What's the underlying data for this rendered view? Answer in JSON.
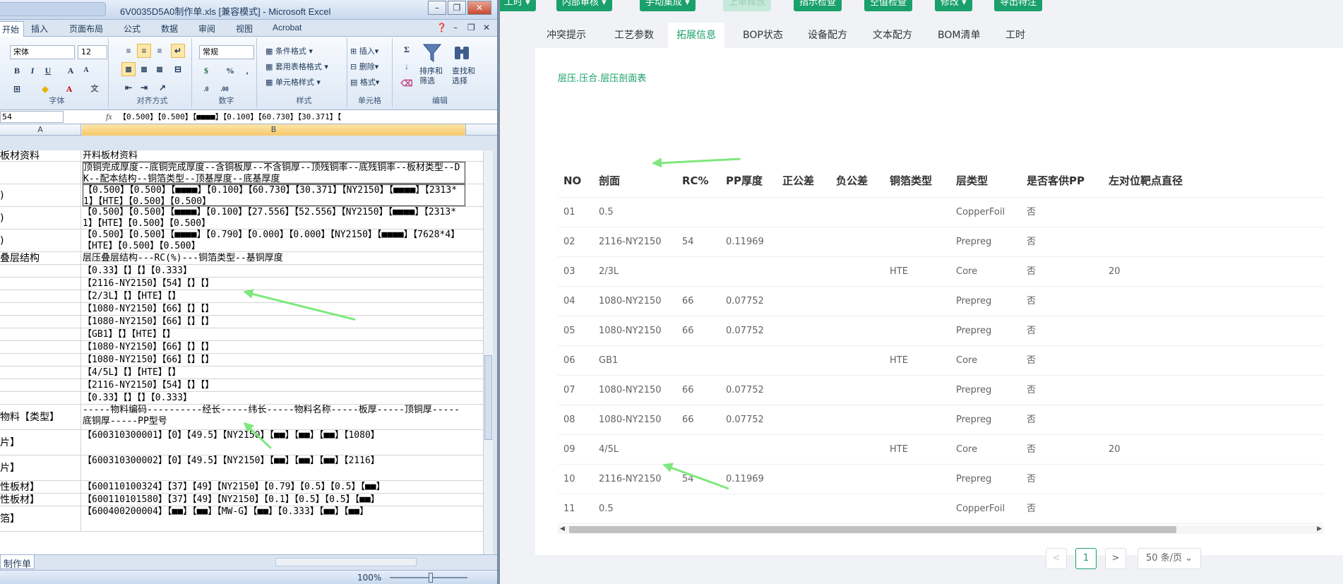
{
  "excel": {
    "title": "6V0035D5A0制作单.xls [兼容模式] - Microsoft Excel",
    "window_buttons": [
      "–",
      "❐",
      "✕"
    ],
    "tabs": [
      "开始",
      "插入",
      "页面布局",
      "公式",
      "数据",
      "审阅",
      "视图",
      "Acrobat"
    ],
    "ribbon": {
      "font_name": "宋体",
      "font_size": "12",
      "number_format": "常规",
      "font_group": "字体",
      "align_group": "对齐方式",
      "number_group": "数字",
      "style_group": "样式",
      "cells_group": "单元格",
      "edit_group": "编辑",
      "cond_format": "条件格式",
      "table_format": "套用表格格式",
      "cell_style": "单元格样式",
      "insert": "插入",
      "delete": "删除",
      "format": "格式",
      "sort_filter": "排序和\n筛选",
      "find_select": "查找和\n选择",
      "percent": "%",
      "comma": ","
    },
    "name_box": "54",
    "formula": "【0.500】【0.500】【■■■■】【0.100】【60.730】【30.371】【",
    "col_a": "A",
    "col_b": "B",
    "rows": [
      {
        "a": "板材资料",
        "b": "开料板材资料",
        "h": 16
      },
      {
        "a": "",
        "b": "顶铜完成厚度--底铜完成厚度--含铜板厚--不含铜厚--顶残铜率--底残铜率--板材类型--DK--配本结构--铜箔类型--顶基厚度--底基厚度",
        "h": 32,
        "box": true
      },
      {
        "a": ")",
        "b": "【0.500】【0.500】【■■■■】【0.100】【60.730】【30.371】【NY2150】【■■■■】【2313*1】【HTE】【0.500】【0.500】",
        "h": 32,
        "box": true
      },
      {
        "a": ")",
        "b": "【0.500】【0.500】【■■■■】【0.100】【27.556】【52.556】【NY2150】【■■■■】【2313*1】【HTE】【0.500】【0.500】",
        "h": 32
      },
      {
        "a": ")",
        "b": "【0.500】【0.500】【■■■■】【0.790】【0.000】【0.000】【NY2150】【■■■■】【7628*4】【HTE】【0.500】【0.500】",
        "h": 32
      },
      {
        "a": "叠层结构",
        "b": "层压叠层结构---RC(%)---铜箔类型--基铜厚度",
        "h": 18
      },
      {
        "a": "",
        "b": "【0.33】【】【】【0.333】",
        "h": 18
      },
      {
        "a": "",
        "b": "【2116-NY2150】【54】【】【】",
        "h": 18
      },
      {
        "a": "",
        "b": "【2/3L】【】【HTE】【】",
        "h": 18
      },
      {
        "a": "",
        "b": "【1080-NY2150】【66】【】【】",
        "h": 18
      },
      {
        "a": "",
        "b": "【1080-NY2150】【66】【】【】",
        "h": 18
      },
      {
        "a": "",
        "b": "【GB1】【】【HTE】【】",
        "h": 18
      },
      {
        "a": "",
        "b": "【1080-NY2150】【66】【】【】",
        "h": 18
      },
      {
        "a": "",
        "b": "【1080-NY2150】【66】【】【】",
        "h": 18
      },
      {
        "a": "",
        "b": "【4/5L】【】【HTE】【】",
        "h": 18
      },
      {
        "a": "",
        "b": "【2116-NY2150】【54】【】【】",
        "h": 18
      },
      {
        "a": "",
        "b": "【0.33】【】【】【0.333】",
        "h": 18
      },
      {
        "a": "物料【类型】",
        "b": "-----物料编码----------经长-----纬长-----物料名称-----板厚-----顶铜厚-----底铜厚-----PP型号",
        "h": 36
      },
      {
        "a": "片】",
        "b": "【600310300001】【0】【49.5】【NY2150】【■■】【■■】【■■】【1080】",
        "h": 36
      },
      {
        "a": "片】",
        "b": "【600310300002】【0】【49.5】【NY2150】【■■】【■■】【■■】【2116】",
        "h": 36
      },
      {
        "a": "性板材】",
        "b": "【600110100324】【37】【49】【NY2150】【0.79】【0.5】【0.5】【■■】",
        "h": 18
      },
      {
        "a": "性板材】",
        "b": "【600110101580】【37】【49】【NY2150】【0.1】【0.5】【0.5】【■■】",
        "h": 18
      },
      {
        "a": "箔】",
        "b": "【600400200004】【■■】【■■】【MW-G】【■■】【0.333】【■■】【■■】",
        "h": 36
      }
    ],
    "sheet_tab": "制作单",
    "zoom": "100%"
  },
  "web": {
    "toolbar": [
      "工时",
      "内部审核",
      "手动集成",
      "上单释放",
      "指示检查",
      "空值检查",
      "修改",
      "导出特注"
    ],
    "tabs": [
      "冲突提示",
      "工艺参数",
      "拓展信息",
      "BOP状态",
      "设备配方",
      "文本配方",
      "BOM清单",
      "工时"
    ],
    "active_tab": "拓展信息",
    "section_title": "层压.压合.层压剖面表",
    "columns": [
      "NO",
      "剖面",
      "RC%",
      "PP厚度",
      "正公差",
      "负公差",
      "铜箔类型",
      "层类型",
      "是否客供PP",
      "左对位靶点直径"
    ],
    "rows": [
      [
        "01",
        "0.5",
        "",
        "",
        "",
        "",
        "",
        "CopperFoil",
        "否",
        ""
      ],
      [
        "02",
        "2116-NY2150",
        "54",
        "0.11969",
        "",
        "",
        "",
        "Prepreg",
        "否",
        ""
      ],
      [
        "03",
        "2/3L",
        "",
        "",
        "",
        "",
        "HTE",
        "Core",
        "否",
        "20"
      ],
      [
        "04",
        "1080-NY2150",
        "66",
        "0.07752",
        "",
        "",
        "",
        "Prepreg",
        "否",
        ""
      ],
      [
        "05",
        "1080-NY2150",
        "66",
        "0.07752",
        "",
        "",
        "",
        "Prepreg",
        "否",
        ""
      ],
      [
        "06",
        "GB1",
        "",
        "",
        "",
        "",
        "HTE",
        "Core",
        "否",
        ""
      ],
      [
        "07",
        "1080-NY2150",
        "66",
        "0.07752",
        "",
        "",
        "",
        "Prepreg",
        "否",
        ""
      ],
      [
        "08",
        "1080-NY2150",
        "66",
        "0.07752",
        "",
        "",
        "",
        "Prepreg",
        "否",
        ""
      ],
      [
        "09",
        "4/5L",
        "",
        "",
        "",
        "",
        "HTE",
        "Core",
        "否",
        "20"
      ],
      [
        "10",
        "2116-NY2150",
        "54",
        "0.11969",
        "",
        "",
        "",
        "Prepreg",
        "否",
        ""
      ],
      [
        "11",
        "0.5",
        "",
        "",
        "",
        "",
        "",
        "CopperFoil",
        "否",
        ""
      ]
    ],
    "pagination": {
      "prev": "<",
      "current": "1",
      "next": ">",
      "page_size": "50 条/页"
    },
    "accent": "#1aa06b",
    "annotation_color": "#7ee87e"
  }
}
